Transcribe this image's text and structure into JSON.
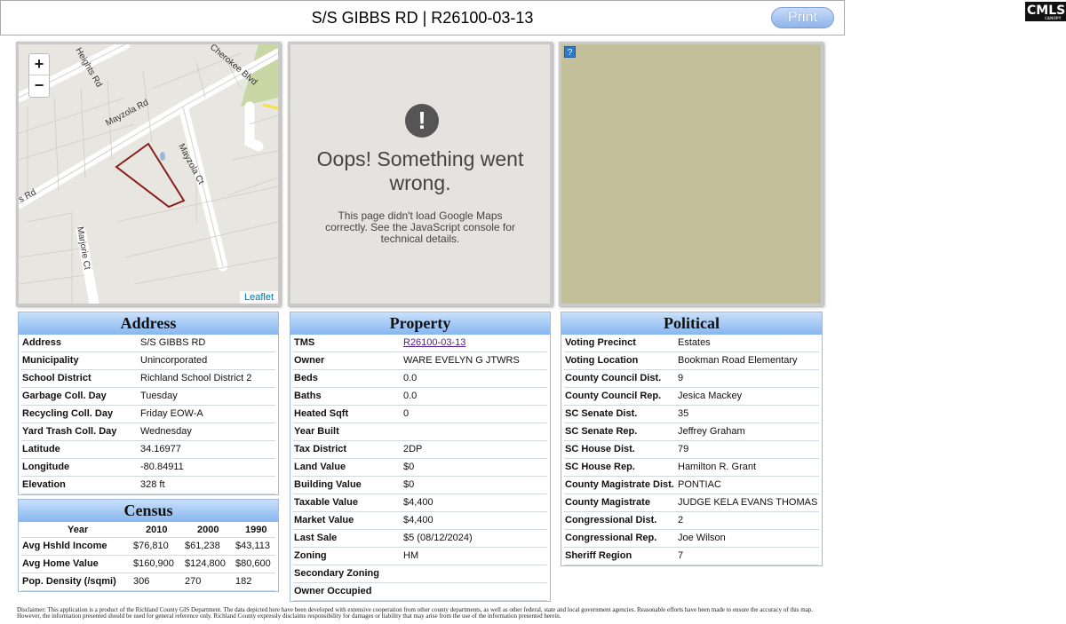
{
  "header": {
    "title": "S/S GIBBS RD | R26100-03-13",
    "print_label": "Print"
  },
  "logo": {
    "text": "CMLS",
    "sub": "CANOPY"
  },
  "map": {
    "zoom_in": "+",
    "zoom_out": "−",
    "attribution": "Leaflet",
    "streets": [
      "Heights Rd",
      "Cherokee Blvd",
      "Mayzola Rd",
      "Mayzola Ct",
      "Marjorie Ct",
      "s Rd"
    ]
  },
  "gmap": {
    "icon": "!",
    "title": "Oops! Something went wrong.",
    "message": "This page didn't load Google Maps correctly. See the JavaScript console for technical details."
  },
  "aerial": {
    "help": "?"
  },
  "address": {
    "title": "Address",
    "rows": [
      {
        "label": "Address",
        "value": "S/S GIBBS RD"
      },
      {
        "label": "Municipality",
        "value": "Unincorporated"
      },
      {
        "label": "School District",
        "value": "Richland School District 2"
      },
      {
        "label": "Garbage Coll. Day",
        "value": "Tuesday"
      },
      {
        "label": "Recycling Coll. Day",
        "value": "Friday EOW-A"
      },
      {
        "label": "Yard Trash Coll. Day",
        "value": "Wednesday"
      },
      {
        "label": "Latitude",
        "value": "34.16977"
      },
      {
        "label": "Longitude",
        "value": "-80.84911"
      },
      {
        "label": "Elevation",
        "value": "328 ft"
      }
    ]
  },
  "census": {
    "title": "Census",
    "headers": [
      "Year",
      "2010",
      "2000",
      "1990"
    ],
    "rows": [
      {
        "label": "Avg Hshld Income",
        "v2010": "$76,810",
        "v2000": "$61,238",
        "v1990": "$43,113"
      },
      {
        "label": "Avg Home Value",
        "v2010": "$160,900",
        "v2000": "$124,800",
        "v1990": "$80,600"
      },
      {
        "label": "Pop. Density (/sqmi)",
        "v2010": "306",
        "v2000": "270",
        "v1990": "182"
      }
    ]
  },
  "property": {
    "title": "Property",
    "rows": [
      {
        "label": "TMS",
        "value": "R26100-03-13"
      },
      {
        "label": "Owner",
        "value": "WARE EVELYN G JTWRS"
      },
      {
        "label": "Beds",
        "value": "0.0"
      },
      {
        "label": "Baths",
        "value": "0.0"
      },
      {
        "label": "Heated Sqft",
        "value": "0"
      },
      {
        "label": "Year Built",
        "value": ""
      },
      {
        "label": "Tax District",
        "value": "2DP"
      },
      {
        "label": "Land Value",
        "value": "$0"
      },
      {
        "label": "Building Value",
        "value": "$0"
      },
      {
        "label": "Taxable Value",
        "value": "$4,400"
      },
      {
        "label": "Market Value",
        "value": "$4,400"
      },
      {
        "label": "Last Sale",
        "value": "$5 (08/12/2024)"
      },
      {
        "label": "Zoning",
        "value": "HM"
      },
      {
        "label": "Secondary Zoning",
        "value": ""
      },
      {
        "label": "Owner Occupied",
        "value": ""
      }
    ]
  },
  "political": {
    "title": "Political",
    "rows": [
      {
        "label": "Voting Precinct",
        "value": "Estates"
      },
      {
        "label": "Voting Location",
        "value": "Bookman Road Elementary"
      },
      {
        "label": "County Council Dist.",
        "value": "9"
      },
      {
        "label": "County Council Rep.",
        "value": "Jesica Mackey"
      },
      {
        "label": "SC Senate Dist.",
        "value": "35"
      },
      {
        "label": "SC Senate Rep.",
        "value": "Jeffrey Graham"
      },
      {
        "label": "SC House Dist.",
        "value": "79"
      },
      {
        "label": "SC House Rep.",
        "value": "Hamilton R. Grant"
      },
      {
        "label": "County Magistrate Dist.",
        "value": "PONTIAC"
      },
      {
        "label": "County Magistrate",
        "value": "JUDGE KELA EVANS THOMAS"
      },
      {
        "label": "Congressional Dist.",
        "value": "2"
      },
      {
        "label": "Congressional Rep.",
        "value": "Joe Wilson"
      },
      {
        "label": "Sheriff Region",
        "value": "7"
      }
    ]
  },
  "disclaimer": "Disclaimer: This application is a product of the Richland County GIS Department. The data depicted here have been developed with extensive cooperation from other county departments, as well as other federal, state and local government agencies. Reasonable efforts have been made to ensure the accuracy of this map. However, the information presented should be used for general reference only. Richland County expressly disclaims responsibility for damages or liability that may arise from the use of the information presented herein."
}
